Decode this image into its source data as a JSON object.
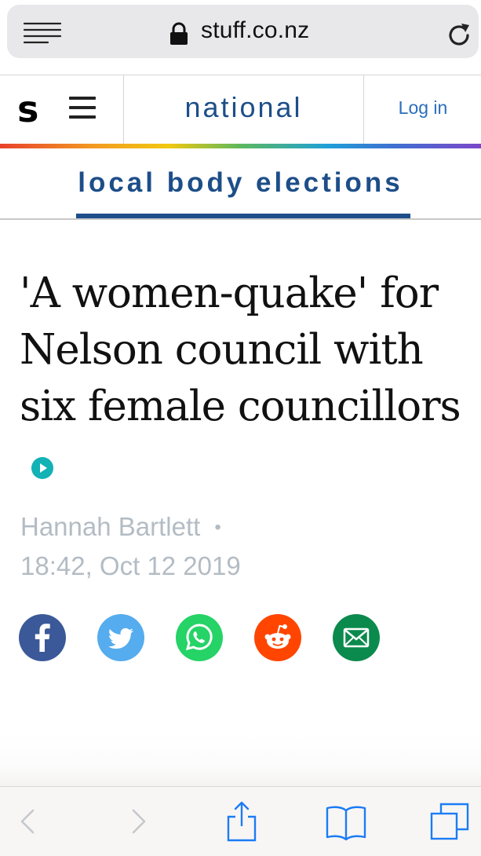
{
  "browser": {
    "url": "stuff.co.nz",
    "icons": [
      "reader-menu-icon",
      "lock-icon",
      "reload-icon"
    ]
  },
  "site_header": {
    "logo": "s",
    "section": "national",
    "login_label": "Log in"
  },
  "subnav": {
    "label": "local body elections"
  },
  "article": {
    "headline_lines": [
      "'A women-quake' for",
      "Nelson council with",
      "six female councillors"
    ],
    "author": "Hannah Bartlett",
    "separator": "•",
    "timestamp": "18:42, Oct 12 2019"
  },
  "share": {
    "buttons": [
      "facebook",
      "twitter",
      "whatsapp",
      "reddit",
      "email"
    ],
    "colors": {
      "facebook": "#3b5998",
      "twitter": "#55acee",
      "whatsapp": "#25d366",
      "reddit": "#ff4500",
      "email": "#0b8a4e"
    }
  },
  "toolbar": {
    "buttons": [
      "back",
      "forward",
      "share",
      "bookmarks",
      "tabs"
    ]
  },
  "colors": {
    "brand_blue": "#1d4e89",
    "link_blue": "#2a6ebb",
    "meta_gray": "#b3bcc4"
  }
}
